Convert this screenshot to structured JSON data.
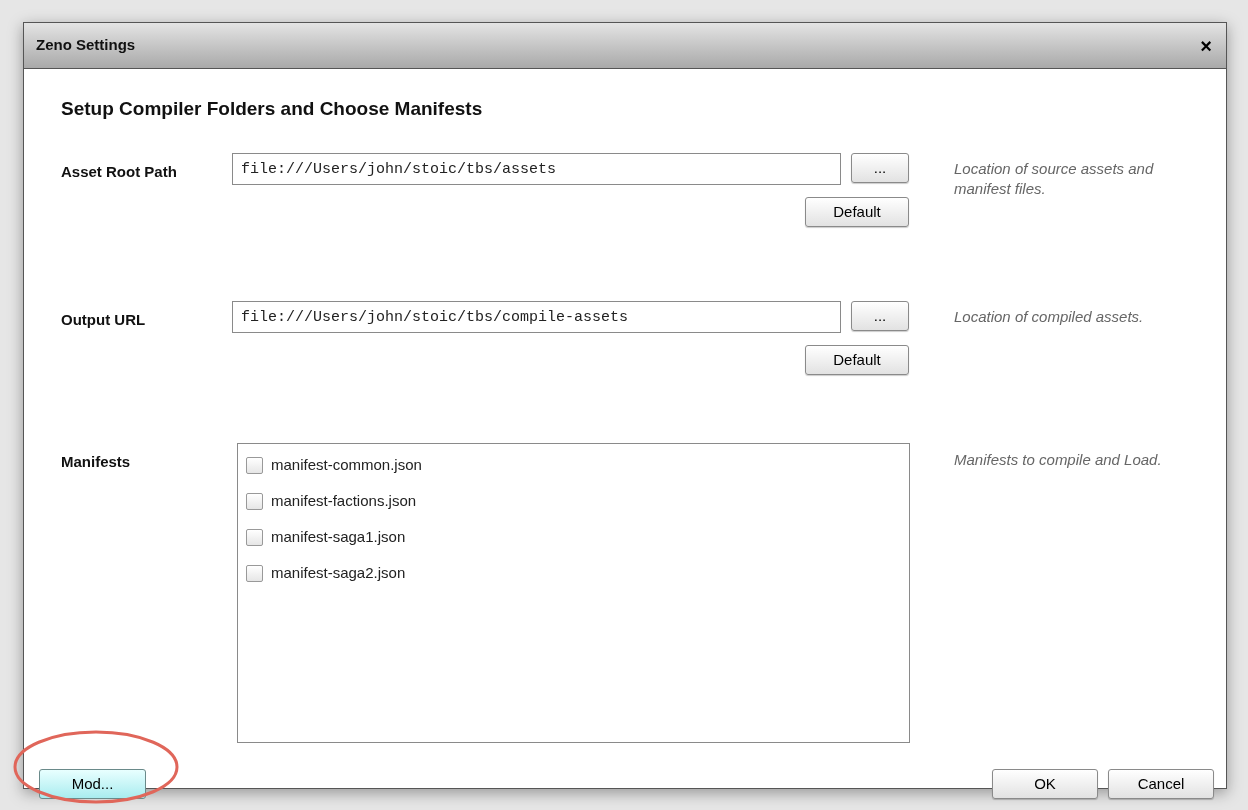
{
  "window": {
    "title": "Zeno Settings",
    "close": "×"
  },
  "heading": "Setup Compiler Folders and Choose Manifests",
  "fields": [
    {
      "label": "Asset Root Path",
      "value": "file:///Users/john/stoic/tbs/assets",
      "browse": "...",
      "default": "Default",
      "description": "Location of source assets and manifest files."
    },
    {
      "label": "Output URL",
      "value": "file:///Users/john/stoic/tbs/compile-assets",
      "browse": "...",
      "default": "Default",
      "description": "Location of compiled assets."
    }
  ],
  "manifests": {
    "label": "Manifests",
    "description": "Manifests to compile and Load.",
    "items": [
      {
        "name": "manifest-common.json",
        "checked": false
      },
      {
        "name": "manifest-factions.json",
        "checked": false
      },
      {
        "name": "manifest-saga1.json",
        "checked": false
      },
      {
        "name": "manifest-saga2.json",
        "checked": false
      }
    ]
  },
  "buttons": {
    "mod": "Mod...",
    "ok": "OK",
    "cancel": "Cancel"
  }
}
